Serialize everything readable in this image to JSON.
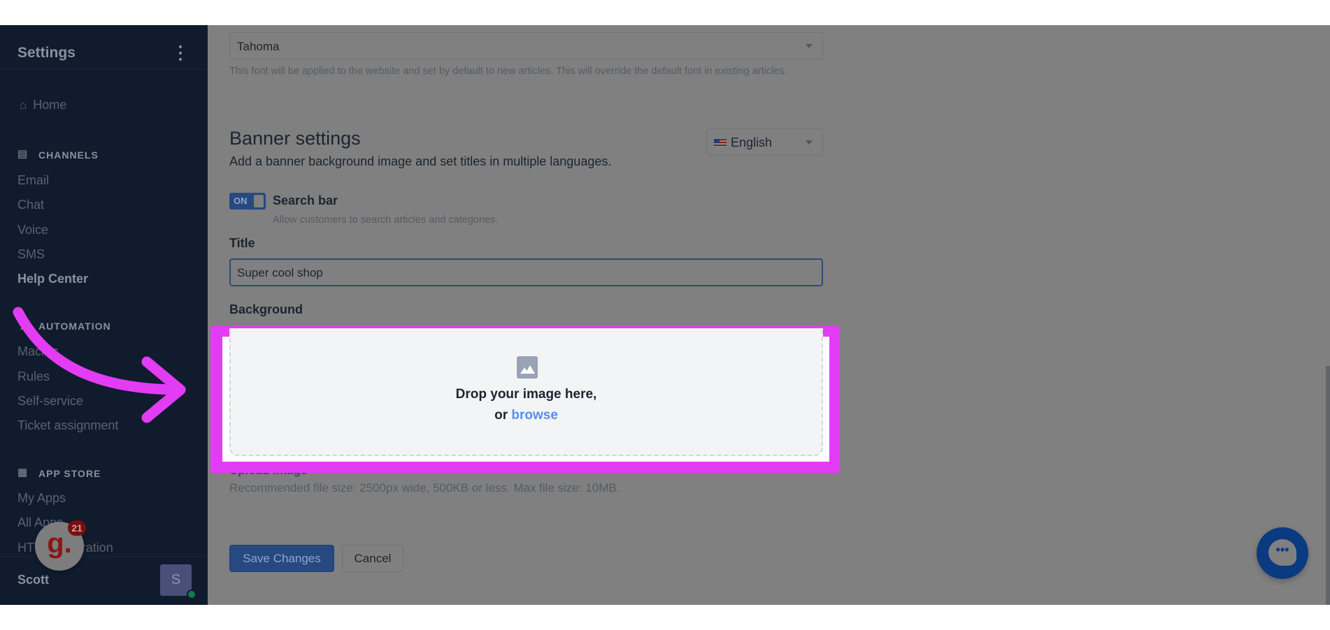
{
  "sidebar": {
    "title": "Settings",
    "home": "Home",
    "sections": [
      {
        "label": "CHANNELS",
        "icon": "chat-icon",
        "items": [
          "Email",
          "Chat",
          "Voice",
          "SMS",
          "Help Center"
        ]
      },
      {
        "label": "AUTOMATION",
        "icon": "automation-icon",
        "items": [
          "Macros",
          "Rules",
          "Self-service",
          "Ticket assignment"
        ]
      },
      {
        "label": "APP STORE",
        "icon": "grid-icon",
        "items": [
          "My Apps",
          "All Apps",
          "HTTP Integration"
        ]
      }
    ],
    "active_item": "Help Center",
    "user": {
      "name": "Scott",
      "avatar_initial": "S",
      "status_color": "#0d7a52"
    }
  },
  "font": {
    "selected": "Tahoma",
    "help": "This font will be applied to the website and set by default to new articles. This will override the default font in existing articles."
  },
  "banner": {
    "heading": "Banner settings",
    "description": "Add a banner background image and set titles in multiple languages.",
    "language": "English",
    "search_bar": {
      "toggle": "ON",
      "enabled": true,
      "label": "Search bar",
      "help": "Allow customers to search articles and categories."
    },
    "title_label": "Title",
    "title_value": "Super cool shop",
    "background_label": "Background",
    "dropzone": {
      "line1": "Drop your image here,",
      "or": "or",
      "browse": "browse"
    },
    "upload_link": "Upload image",
    "recommendation": "Recommended file size: 2500px wide, 500KB or less. Max file size: 10MB."
  },
  "actions": {
    "save": "Save Changes",
    "cancel": "Cancel"
  },
  "guidde_badge": {
    "logo": "g.",
    "count": "21"
  },
  "colors": {
    "highlight": "#e33cf5",
    "accent": "#26497f",
    "link": "#5b8def"
  }
}
